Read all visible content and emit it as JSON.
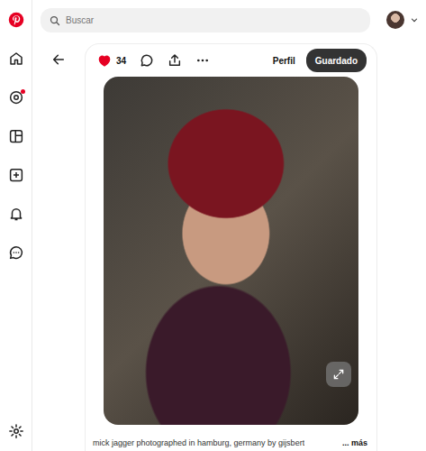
{
  "sidebar": {
    "items": [
      {
        "badge": false
      },
      {
        "badge": false
      },
      {
        "badge": true
      },
      {
        "badge": false
      },
      {
        "badge": false
      },
      {
        "badge": false
      },
      {
        "badge": false
      }
    ],
    "footer": {
      "badge": false
    }
  },
  "search": {
    "placeholder": "Buscar"
  },
  "pin": {
    "liked": true,
    "likes": "34",
    "profile_label": "Perfil",
    "save_button": {
      "label": "Guardado",
      "saved": true
    },
    "caption": "mick jagger photographed in hamburg, germany by gijsbert",
    "more": "... más"
  }
}
